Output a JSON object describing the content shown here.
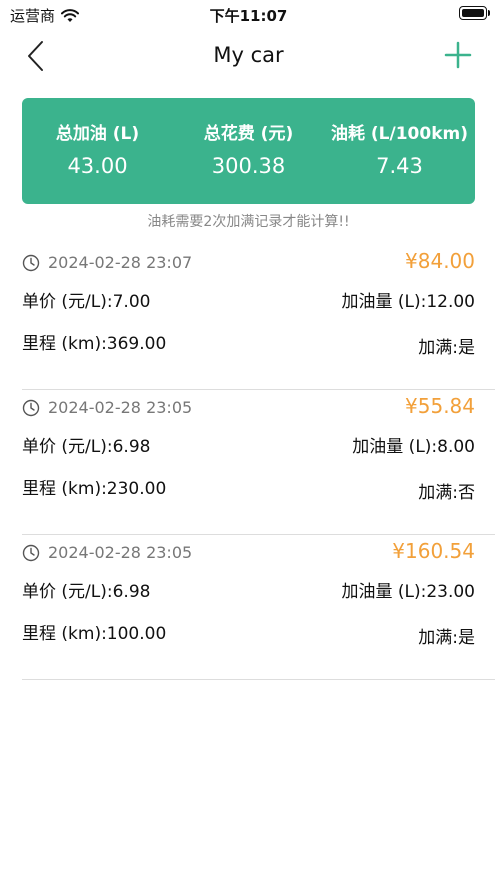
{
  "status": {
    "carrier": "运营商",
    "time": "下午11:07"
  },
  "nav": {
    "title": "My car"
  },
  "summary": [
    {
      "label": "总加油 (L)",
      "value": "43.00"
    },
    {
      "label": "总花费 (元)",
      "value": "300.38"
    },
    {
      "label": "油耗 (L/100km)",
      "value": "7.43"
    }
  ],
  "hint": "油耗需要2次加满记录才能计算!!",
  "colors": {
    "accent": "#3bb38d",
    "price": "#f2a03a"
  },
  "records": [
    {
      "time": "2024-02-28 23:07",
      "price": "¥84.00",
      "unit_price": "单价 (元/L):7.00",
      "amount": "加油量 (L):12.00",
      "mileage": "里程 (km):369.00",
      "full": "加满:是"
    },
    {
      "time": "2024-02-28 23:05",
      "price": "¥55.84",
      "unit_price": "单价 (元/L):6.98",
      "amount": "加油量 (L):8.00",
      "mileage": "里程 (km):230.00",
      "full": "加满:否"
    },
    {
      "time": "2024-02-28 23:05",
      "price": "¥160.54",
      "unit_price": "单价 (元/L):6.98",
      "amount": "加油量 (L):23.00",
      "mileage": "里程 (km):100.00",
      "full": "加满:是"
    }
  ]
}
